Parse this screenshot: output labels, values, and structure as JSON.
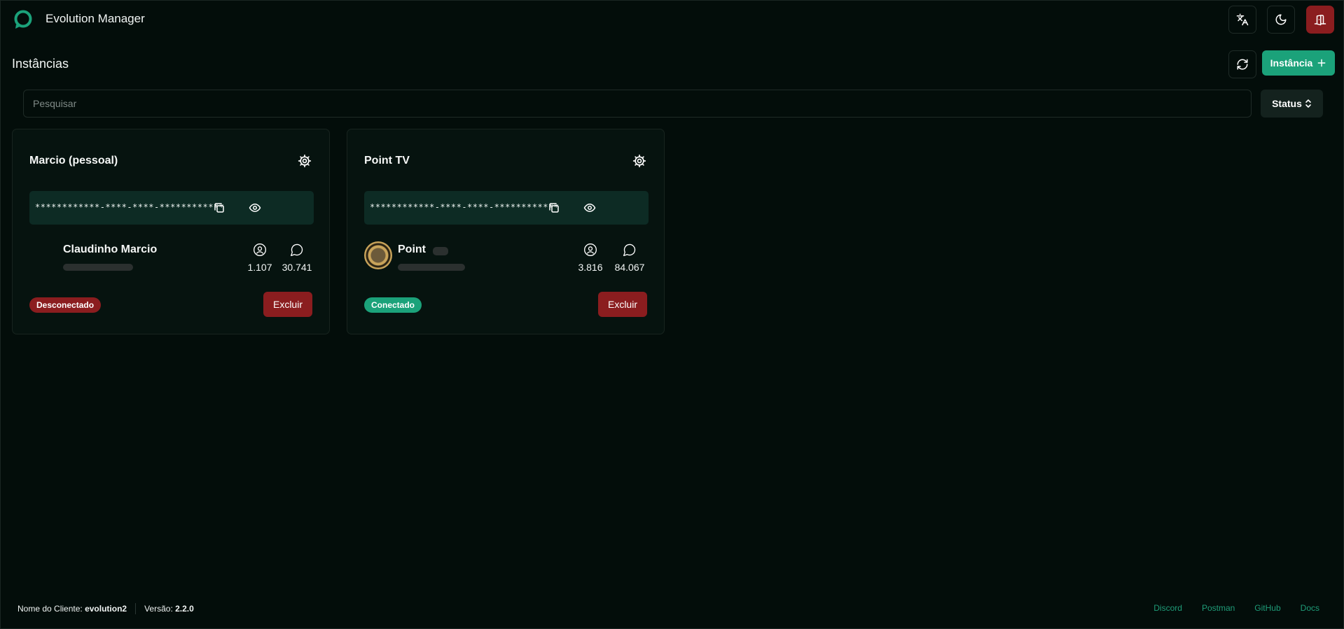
{
  "header": {
    "title": "Evolution Manager",
    "logo_icon": "chat-bubble-logo",
    "buttons": [
      "language-icon",
      "moon-icon",
      "logout-door-icon"
    ]
  },
  "page": {
    "title": "Instâncias",
    "new_instance_label": "Instância",
    "refresh_icon": "refresh-icon"
  },
  "search": {
    "placeholder": "Pesquisar",
    "status_label": "Status"
  },
  "instances": [
    {
      "name": "Marcio (pessoal)",
      "token": "************-****-****-************",
      "profile_name": "Claudinho Marcio",
      "contacts": "1.107",
      "chats": "30.741",
      "status": "Desconectado",
      "delete_label": "Excluir"
    },
    {
      "name": "Point TV",
      "token": "************-****-****-************",
      "profile_name": "Point",
      "contacts": "3.816",
      "chats": "84.067",
      "status": "Conectado",
      "delete_label": "Excluir"
    }
  ],
  "footer": {
    "client_label": "Nome do Cliente:",
    "client_value": "evolution2",
    "version_label": "Versão:",
    "version_value": "2.2.0",
    "links": [
      "Discord",
      "Postman",
      "GitHub",
      "Docs"
    ]
  },
  "colors": {
    "background": "#030d0a",
    "accent": "#1ba27a",
    "danger": "#8b1d1f",
    "token_bg": "#0d2b24"
  }
}
